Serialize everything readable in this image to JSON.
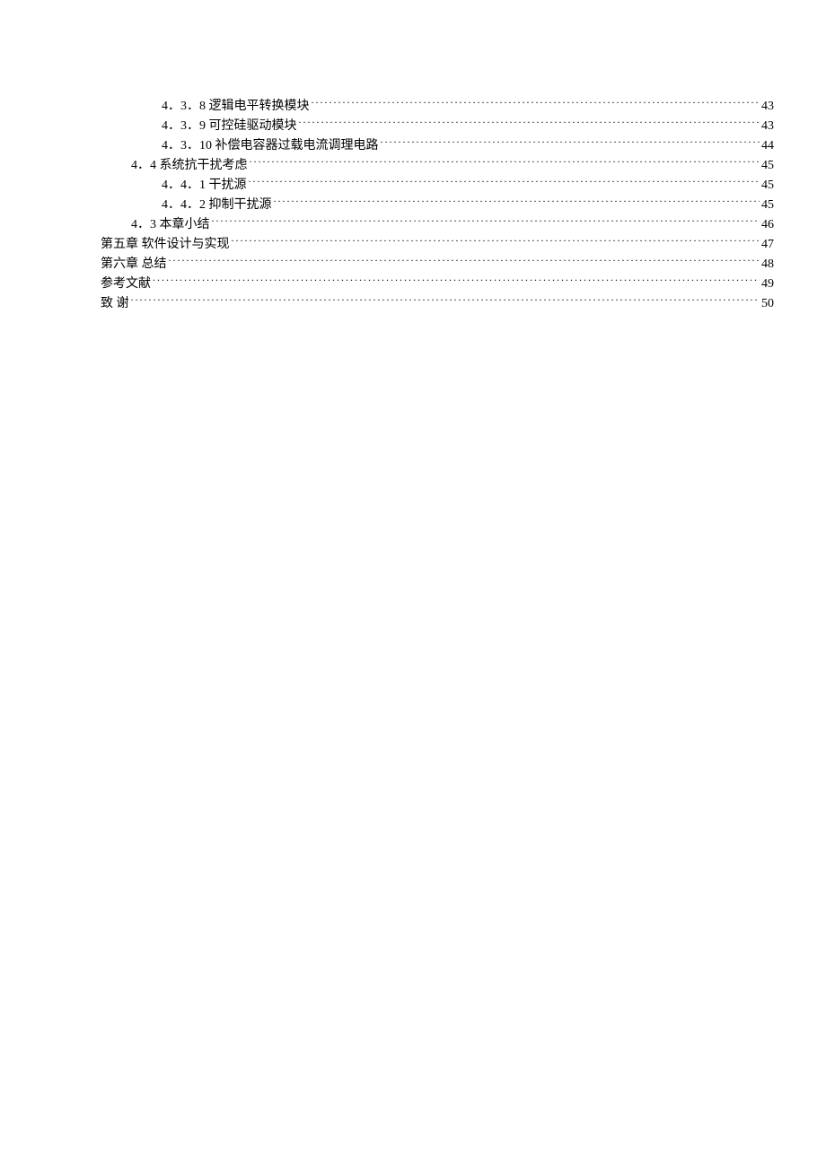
{
  "toc_entries": [
    {
      "label": "4．3．8 逻辑电平转换模块",
      "page": "43",
      "indent": 2
    },
    {
      "label": "4．3．9 可控硅驱动模块",
      "page": "43",
      "indent": 2
    },
    {
      "label": "4．3．10 补偿电容器过载电流调理电路",
      "page": "44",
      "indent": 2
    },
    {
      "label": "4．4 系统抗干扰考虑",
      "page": "45",
      "indent": 1
    },
    {
      "label": "4．4．1 干扰源",
      "page": "45",
      "indent": 2
    },
    {
      "label": "4．4．2 抑制干扰源",
      "page": "45",
      "indent": 2
    },
    {
      "label": "4．3 本章小结",
      "page": "46",
      "indent": 1
    },
    {
      "label": "第五章  软件设计与实现",
      "page": "47",
      "indent": 0
    },
    {
      "label": "第六章  总结",
      "page": "48",
      "indent": 0
    },
    {
      "label": "参考文献",
      "page": "49",
      "indent": 0
    },
    {
      "label": "致        谢",
      "page": "50",
      "indent": 0
    }
  ]
}
